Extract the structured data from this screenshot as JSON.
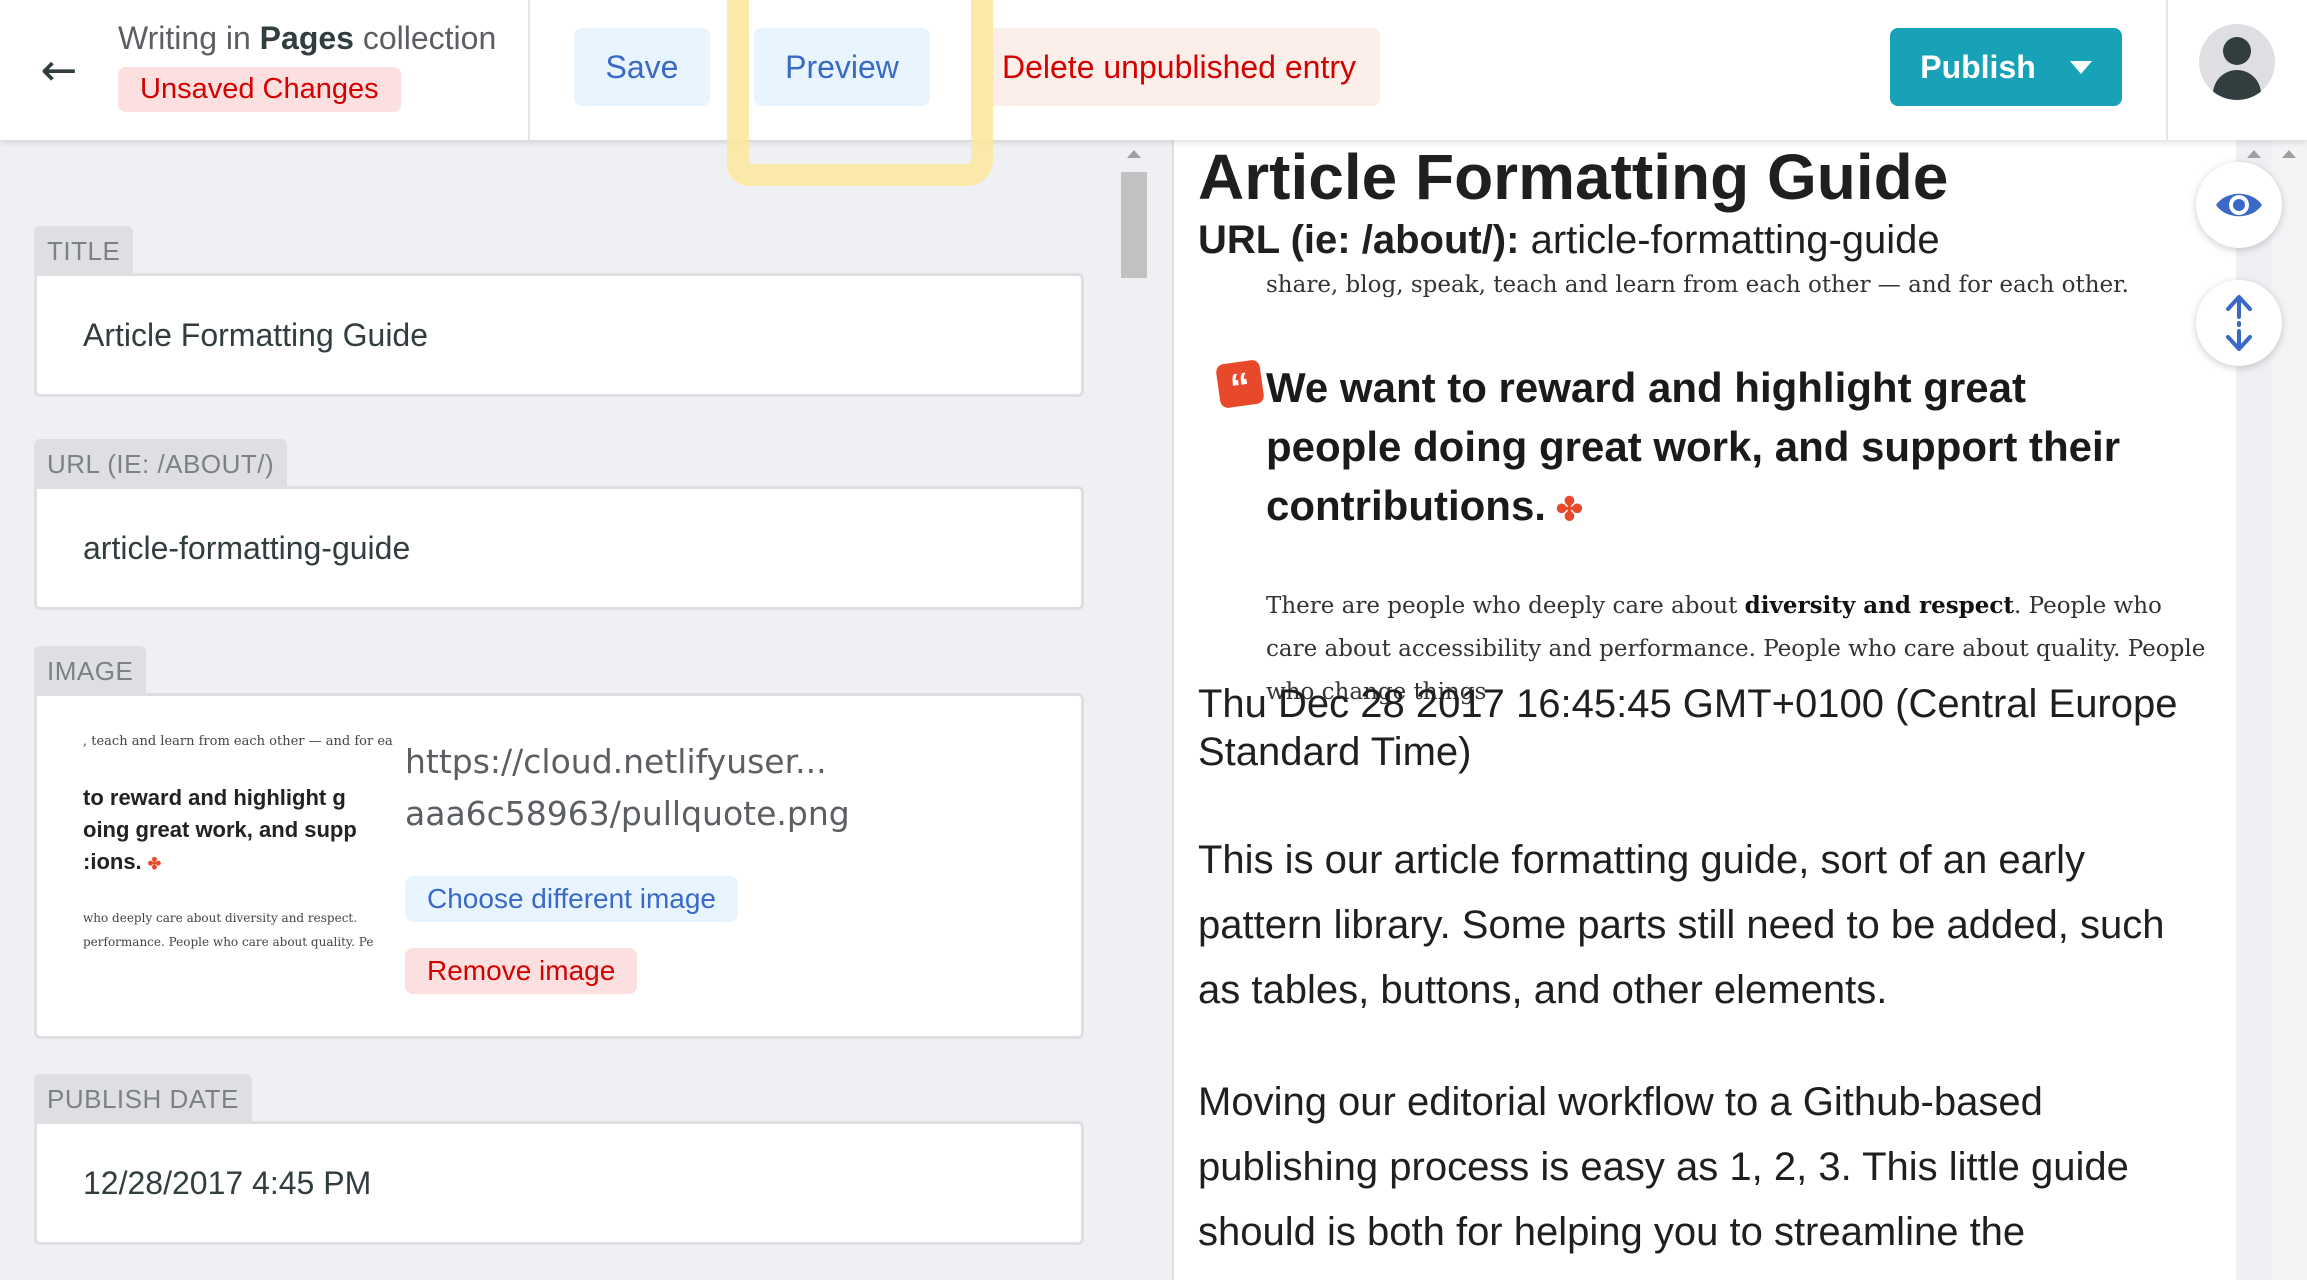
{
  "topbar": {
    "back_icon": "arrow-left-icon",
    "back_glyph": "←",
    "writing_in_prefix": "Writing in",
    "collection_name": "Pages",
    "writing_in_suffix": "collection",
    "unsaved_label": "Unsaved Changes",
    "save_label": "Save",
    "preview_label": "Preview",
    "delete_label": "Delete unpublished entry",
    "publish_label": "Publish",
    "publish_caret_icon": "caret-down-icon",
    "avatar_icon": "user-avatar-icon"
  },
  "fields": {
    "title": {
      "label": "TITLE",
      "value": "Article Formatting Guide"
    },
    "url": {
      "label": "URL (IE: /ABOUT/)",
      "value": "article-formatting-guide"
    },
    "image": {
      "label": "IMAGE",
      "url_line1": "https://cloud.netlifyuser...",
      "url_line2": "aaa6c58963/pullquote.png",
      "choose_label": "Choose different image",
      "remove_label": "Remove image",
      "thumb_line1": ", teach and learn from each other — and for each",
      "thumb_quote_1": " to reward and highlight g",
      "thumb_quote_2": "oing great work, and supp",
      "thumb_quote_3": ":ions.",
      "thumb_small_1": " who deeply care about diversity and respect.",
      "thumb_small_2": " performance. People who care about quality. Pe"
    },
    "publish_date": {
      "label": "PUBLISH DATE",
      "value": "12/28/2017 4:45 PM"
    }
  },
  "preview": {
    "title": "Article Formatting Guide",
    "url_label": "URL (ie: /about/):",
    "url_value": "article-formatting-guide",
    "image_top_line": "share, blog, speak, teach and learn from each other — and for each other.",
    "quote_text": "We want to reward and highlight great people doing great work, and support their contributions.",
    "quote_icon": "quote-icon",
    "twitter_icon": "twitter-bird-icon",
    "body_small_1": "There are people who deeply care about ",
    "body_small_bold": "diversity and respect",
    "body_small_2": ". People who care about accessibility and performance. People who care about quality. People who change things",
    "date_text": "Thu Dec 28 2017 16:45:45 GMT+0100 (Central Europe Standard Time)",
    "para1": "This is our article formatting guide, sort of an early pattern library. Some parts still need to be added, such as tables, buttons, and other elements.",
    "para2": "Moving our editorial workflow to a Github-based publishing process is easy as 1, 2, 3. This little guide should is both for helping you to streamline the"
  },
  "floating": {
    "eye_icon": "eye-icon",
    "sync_scroll_icon": "sync-scroll-icon"
  },
  "colors": {
    "accent_blue": "#3a69c7",
    "publish_teal": "#17a2b8",
    "danger_red": "#d50000",
    "highlight_yellow": "#fce9a2"
  }
}
